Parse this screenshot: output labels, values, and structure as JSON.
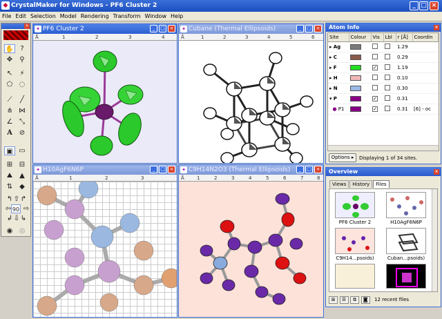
{
  "app": {
    "title": "CrystalMaker for Windows - PF6 Cluster 2"
  },
  "menu": [
    "File",
    "Edit",
    "Selection",
    "Model",
    "Rendering",
    "Transform",
    "Window",
    "Help"
  ],
  "toolbox": {
    "rotate_value": "90"
  },
  "windows": {
    "w1": {
      "title": "PF6 Cluster 2",
      "ruler_start": "Å",
      "ruler": [
        "1",
        "2",
        "3",
        "4"
      ]
    },
    "w2": {
      "title": "Cubane (Thermal Ellipsoids)",
      "ruler_start": "Å",
      "ruler": [
        "1",
        "2",
        "3",
        "4",
        "5",
        "6"
      ]
    },
    "w3": {
      "title": "H10AgF6N6P",
      "ruler_start": "Å",
      "ruler": [
        "1",
        "2",
        "3"
      ]
    },
    "w4": {
      "title": "C9H14N2O3 (Thermal Ellipsoids)",
      "ruler_start": "Å",
      "ruler": [
        "1",
        "2",
        "3",
        "4",
        "5",
        "6",
        "7",
        "8"
      ]
    }
  },
  "atom_info": {
    "title": "Atom Info",
    "columns": [
      "Site",
      "Colour",
      "Vis",
      "Lbl",
      "r [Å]",
      "Coordin"
    ],
    "rows": [
      {
        "site": "Ag",
        "colour": "#7a7a7a",
        "vis": "",
        "lbl": "",
        "r": "1.29",
        "coord": ""
      },
      {
        "site": "C",
        "colour": "#8a5a4a",
        "vis": "",
        "lbl": "",
        "r": "0.29",
        "coord": ""
      },
      {
        "site": "F",
        "colour": "#22dd22",
        "vis": "✓",
        "lbl": "",
        "r": "1.19",
        "coord": ""
      },
      {
        "site": "H",
        "colour": "#f0b8b8",
        "vis": "",
        "lbl": "",
        "r": "0.10",
        "coord": ""
      },
      {
        "site": "N",
        "colour": "#9ab8e8",
        "vis": "",
        "lbl": "",
        "r": "0.30",
        "coord": ""
      },
      {
        "site": "P",
        "colour": "#880088",
        "vis": "✓",
        "lbl": "",
        "r": "0.31",
        "coord": ""
      },
      {
        "site": "P1",
        "colour": "#880088",
        "vis": "✓",
        "lbl": "",
        "r": "0.31",
        "coord": "[6] - oc"
      }
    ],
    "options_label": "Options",
    "status": "Displaying 1 of 34 sites."
  },
  "overview": {
    "title": "Overview",
    "tabs": [
      "Views",
      "History",
      "Files"
    ],
    "files": [
      "PF6 Cluster 2",
      "H10AgF6N6P",
      "C9H14...psoids)",
      "Cuban...psoids)"
    ],
    "status": "12 recent files"
  }
}
